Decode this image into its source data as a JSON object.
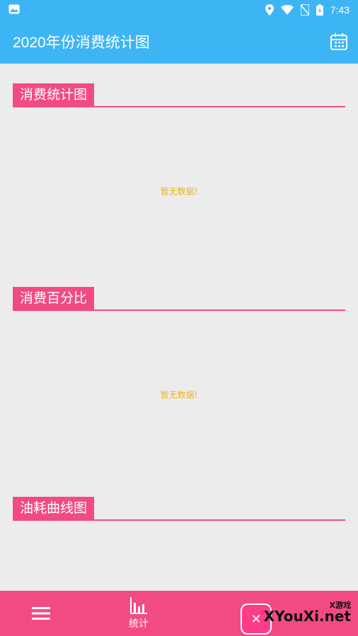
{
  "status_bar": {
    "time": "7:43"
  },
  "app_bar": {
    "title": "2020年份消费统计图",
    "calendar_icon": "calendar-icon"
  },
  "sections": [
    {
      "title": "消费统计图",
      "empty_text": "暂无数据!"
    },
    {
      "title": "消费百分比",
      "empty_text": "暂无数据!"
    },
    {
      "title": "油耗曲线图"
    }
  ],
  "bottom_nav": {
    "items": [
      {
        "icon": "menu-icon"
      },
      {
        "icon": "bar-chart-icon",
        "label": "统计"
      }
    ]
  },
  "watermark": {
    "small": "X游戏",
    "main": "XYouXi.net"
  },
  "colors": {
    "primary": "#3db5f5",
    "accent": "#f24b83",
    "empty_text": "#f2b21c",
    "background": "#ececec"
  }
}
